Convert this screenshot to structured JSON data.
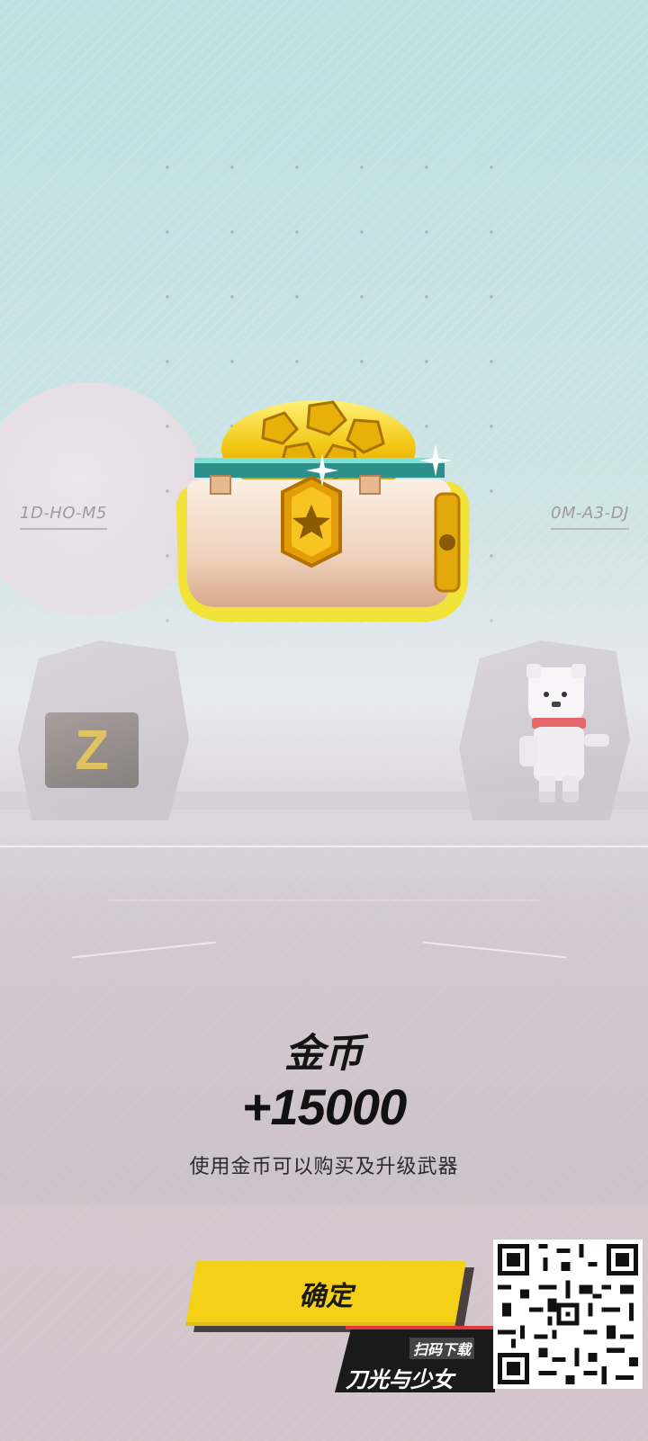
{
  "scene": {
    "left_code": "1D-HO-M5",
    "right_code": "0M-A3-DJ",
    "z_label": "Z"
  },
  "reward": {
    "item_name": "金币",
    "amount": "+15000",
    "description": "使用金币可以购买及升级武器"
  },
  "actions": {
    "confirm_label": "确定"
  },
  "promo": {
    "scan_label": "扫码下载",
    "game_title": "刀光与少女"
  },
  "colors": {
    "accent_yellow": "#f4d019",
    "chest_gold": "#f2c40f",
    "text_dark": "#141414"
  }
}
